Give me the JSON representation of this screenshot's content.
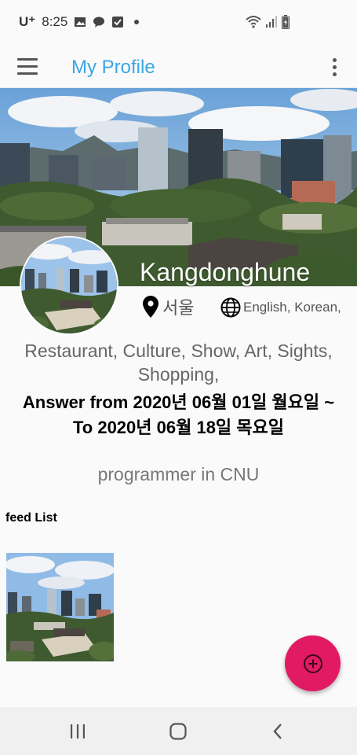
{
  "status_bar": {
    "carrier": "U⁺",
    "time": "8:25",
    "icons": [
      "image-icon",
      "talk-icon",
      "check-icon",
      "dot-icon",
      "wifi-icon",
      "signal-icon",
      "battery-icon"
    ]
  },
  "app_bar": {
    "title": "My Profile",
    "menu_icon": "hamburger-menu-icon",
    "more_icon": "more-vert-icon",
    "title_color": "#3aa6e3"
  },
  "profile": {
    "name": "Kangdonghune",
    "location": "서울",
    "languages": "English, Korean,",
    "interests_line1": "Restaurant, Culture, Show, Art, Sights,",
    "interests_line2": "Shopping,",
    "answer_line1": "Answer from  2020년 06월  01일 월요일 ~",
    "answer_line2": "To  2020년 06월  18일 목요일",
    "job": "programmer in  CNU"
  },
  "feed": {
    "title": "feed List"
  },
  "fab": {
    "icon": "add-circle-icon",
    "color": "#e11a63"
  },
  "nav": {
    "recent_icon": "recent-apps-icon",
    "home_icon": "home-icon",
    "back_icon": "back-icon"
  }
}
